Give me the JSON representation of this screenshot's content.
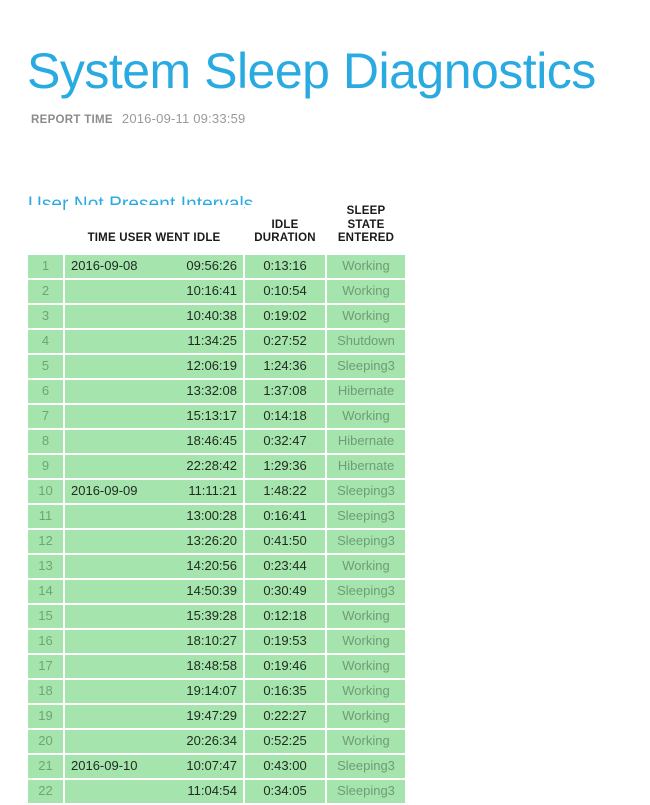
{
  "document": {
    "title": "System Sleep Diagnostics",
    "accent_color": "#29ABE2",
    "row_color": "#A5E4AC",
    "index_color": "#AFE8B6"
  },
  "report_time": {
    "label": "REPORT TIME",
    "value": "2016-09-11 09:33:59"
  },
  "section": {
    "heading": "User Not Present Intervals"
  },
  "table": {
    "headers": {
      "index": "",
      "when": "TIME USER WENT IDLE",
      "duration_line1": "IDLE",
      "duration_line2": "DURATION",
      "state_line1": "SLEEP",
      "state_line2": "STATE",
      "state_line3": "ENTERED"
    },
    "rows": [
      {
        "index": "1",
        "date": "2016-09-08",
        "time": "09:56:26",
        "duration": "0:13:16",
        "state": "Working"
      },
      {
        "index": "2",
        "date": "",
        "time": "10:16:41",
        "duration": "0:10:54",
        "state": "Working"
      },
      {
        "index": "3",
        "date": "",
        "time": "10:40:38",
        "duration": "0:19:02",
        "state": "Working"
      },
      {
        "index": "4",
        "date": "",
        "time": "11:34:25",
        "duration": "0:27:52",
        "state": "Shutdown"
      },
      {
        "index": "5",
        "date": "",
        "time": "12:06:19",
        "duration": "1:24:36",
        "state": "Sleeping3"
      },
      {
        "index": "6",
        "date": "",
        "time": "13:32:08",
        "duration": "1:37:08",
        "state": "Hibernate"
      },
      {
        "index": "7",
        "date": "",
        "time": "15:13:17",
        "duration": "0:14:18",
        "state": "Working"
      },
      {
        "index": "8",
        "date": "",
        "time": "18:46:45",
        "duration": "0:32:47",
        "state": "Hibernate"
      },
      {
        "index": "9",
        "date": "",
        "time": "22:28:42",
        "duration": "1:29:36",
        "state": "Hibernate"
      },
      {
        "index": "10",
        "date": "2016-09-09",
        "time": "11:11:21",
        "duration": "1:48:22",
        "state": "Sleeping3"
      },
      {
        "index": "11",
        "date": "",
        "time": "13:00:28",
        "duration": "0:16:41",
        "state": "Sleeping3"
      },
      {
        "index": "12",
        "date": "",
        "time": "13:26:20",
        "duration": "0:41:50",
        "state": "Sleeping3"
      },
      {
        "index": "13",
        "date": "",
        "time": "14:20:56",
        "duration": "0:23:44",
        "state": "Working"
      },
      {
        "index": "14",
        "date": "",
        "time": "14:50:39",
        "duration": "0:30:49",
        "state": "Sleeping3"
      },
      {
        "index": "15",
        "date": "",
        "time": "15:39:28",
        "duration": "0:12:18",
        "state": "Working"
      },
      {
        "index": "16",
        "date": "",
        "time": "18:10:27",
        "duration": "0:19:53",
        "state": "Working"
      },
      {
        "index": "17",
        "date": "",
        "time": "18:48:58",
        "duration": "0:19:46",
        "state": "Working"
      },
      {
        "index": "18",
        "date": "",
        "time": "19:14:07",
        "duration": "0:16:35",
        "state": "Working"
      },
      {
        "index": "19",
        "date": "",
        "time": "19:47:29",
        "duration": "0:22:27",
        "state": "Working"
      },
      {
        "index": "20",
        "date": "",
        "time": "20:26:34",
        "duration": "0:52:25",
        "state": "Working"
      },
      {
        "index": "21",
        "date": "2016-09-10",
        "time": "10:07:47",
        "duration": "0:43:00",
        "state": "Sleeping3"
      },
      {
        "index": "22",
        "date": "",
        "time": "11:04:54",
        "duration": "0:34:05",
        "state": "Sleeping3"
      }
    ]
  }
}
